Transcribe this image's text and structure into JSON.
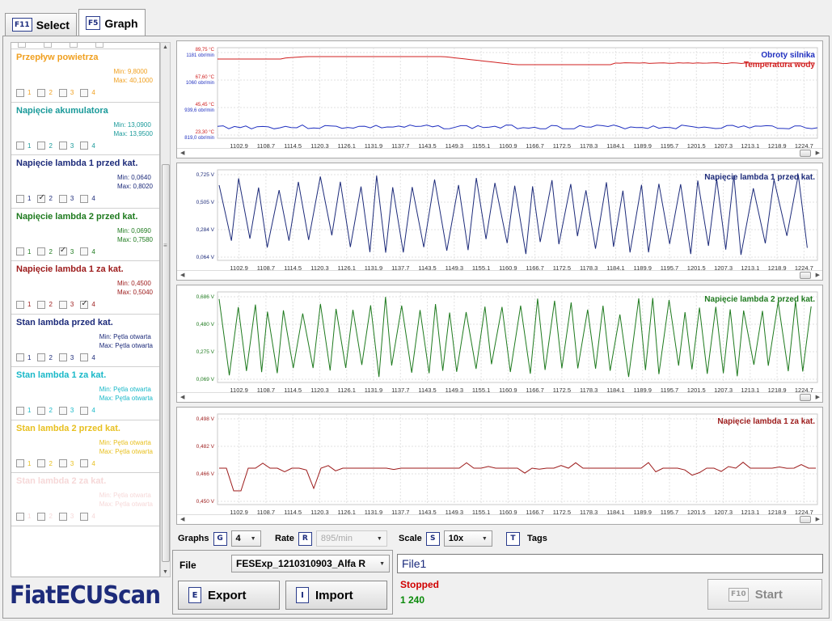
{
  "tabs": [
    {
      "key": "F11",
      "label": "Select",
      "active": false
    },
    {
      "key": "F5",
      "label": "Graph",
      "active": true
    }
  ],
  "parameters": [
    {
      "name": "Przepływ powietrza",
      "color": "#f0a020",
      "min": "Min: 9,8000",
      "max": "Max: 40,1000",
      "checks": [
        false,
        false,
        false,
        false
      ]
    },
    {
      "name": "Napięcie akumulatora",
      "color": "#1a9a9a",
      "min": "Min: 13,0900",
      "max": "Max: 13,9500",
      "checks": [
        false,
        false,
        false,
        false
      ]
    },
    {
      "name": "Napięcie lambda 1 przed kat.",
      "color": "#1d2b7a",
      "min": "Min: 0,0640",
      "max": "Max: 0,8020",
      "checks": [
        false,
        true,
        false,
        false
      ]
    },
    {
      "name": "Napięcie lambda 2 przed kat.",
      "color": "#1e7a1e",
      "min": "Min: 0,0690",
      "max": "Max: 0,7580",
      "checks": [
        false,
        false,
        true,
        false
      ]
    },
    {
      "name": "Napięcie lambda 1 za kat.",
      "color": "#9c1a1a",
      "min": "Min: 0,4500",
      "max": "Max: 0,5040",
      "checks": [
        false,
        false,
        false,
        true
      ]
    },
    {
      "name": "Stan lambda przed kat.",
      "color": "#1d2b7a",
      "min": "Min: Pętla otwarta",
      "max": "Max: Pętla otwarta",
      "checks": [
        false,
        false,
        false,
        false
      ]
    },
    {
      "name": "Stan lambda 1 za kat.",
      "color": "#18b8c8",
      "min": "Min: Pętla otwarta",
      "max": "Max: Pętla otwarta",
      "checks": [
        false,
        false,
        false,
        false
      ]
    },
    {
      "name": "Stan lambda 2 przed kat.",
      "color": "#e8c020",
      "min": "Min: Pętla otwarta",
      "max": "Max: Pętla otwarta",
      "checks": [
        false,
        false,
        false,
        false
      ]
    },
    {
      "name": "Stan lambda 2 za kat.",
      "color": "#f6d8d8",
      "min": "Min: Pętla otwarta",
      "max": "Max: Pętla otwarta",
      "checks": [
        false,
        false,
        false,
        false
      ]
    }
  ],
  "check_labels": [
    "1",
    "2",
    "3",
    "4"
  ],
  "logo": "FiatECUScan",
  "x_ticks": [
    "1102,9",
    "1108,7",
    "1114,5",
    "1120,3",
    "1126,1",
    "1131,9",
    "1137,7",
    "1143,5",
    "1149,3",
    "1155,1",
    "1160,9",
    "1166,7",
    "1172,5",
    "1178,3",
    "1184,1",
    "1189,9",
    "1195,7",
    "1201,5",
    "1207,3",
    "1213,1",
    "1218,9",
    "1224,7"
  ],
  "charts": [
    {
      "legends": [
        {
          "text": "Obroty silnika",
          "color": "#2030c0"
        },
        {
          "text": "Temperatura wody",
          "color": "#d02020"
        }
      ],
      "y_labels": [
        {
          "top": "89,75 °C",
          "bottom": "1181 obr/min"
        },
        {
          "top": "67,60 °C",
          "bottom": "1060 obr/min"
        },
        {
          "top": "45,45 °C",
          "bottom": "939,6 obr/min"
        },
        {
          "top": "23,30 °C",
          "bottom": "819,0 obr/min"
        }
      ]
    },
    {
      "legends": [
        {
          "text": "Napięcie lambda 1 przed kat.",
          "color": "#1d2b7a"
        }
      ],
      "y_labels": [
        "0,725 V",
        "0,505 V",
        "0,284 V",
        "0,064 V"
      ]
    },
    {
      "legends": [
        {
          "text": "Napięcie lambda 2 przed kat.",
          "color": "#1e7a1e"
        }
      ],
      "y_labels": [
        "0,686 V",
        "0,480 V",
        "0,275 V",
        "0,069 V"
      ]
    },
    {
      "legends": [
        {
          "text": "Napięcie lambda 1 za kat.",
          "color": "#9c1a1a"
        }
      ],
      "y_labels": [
        "0,498 V",
        "0,482 V",
        "0,466 V",
        "0,450 V"
      ]
    }
  ],
  "controls": {
    "graphs_label": "Graphs",
    "graphs_key": "G",
    "graphs_value": "4",
    "rate_label": "Rate",
    "rate_key": "R",
    "rate_value": "895/min",
    "scale_label": "Scale",
    "scale_key": "S",
    "scale_value": "10x",
    "tags_key": "T",
    "tags_label": "Tags"
  },
  "file": {
    "label": "File",
    "selected": "FESExp_1210310903_Alfa R",
    "export_key": "E",
    "export_label": "Export",
    "import_key": "I",
    "import_label": "Import",
    "name": "File1"
  },
  "status": {
    "state": "Stopped",
    "count": "1 240"
  },
  "start": {
    "key": "F10",
    "label": "Start"
  }
}
